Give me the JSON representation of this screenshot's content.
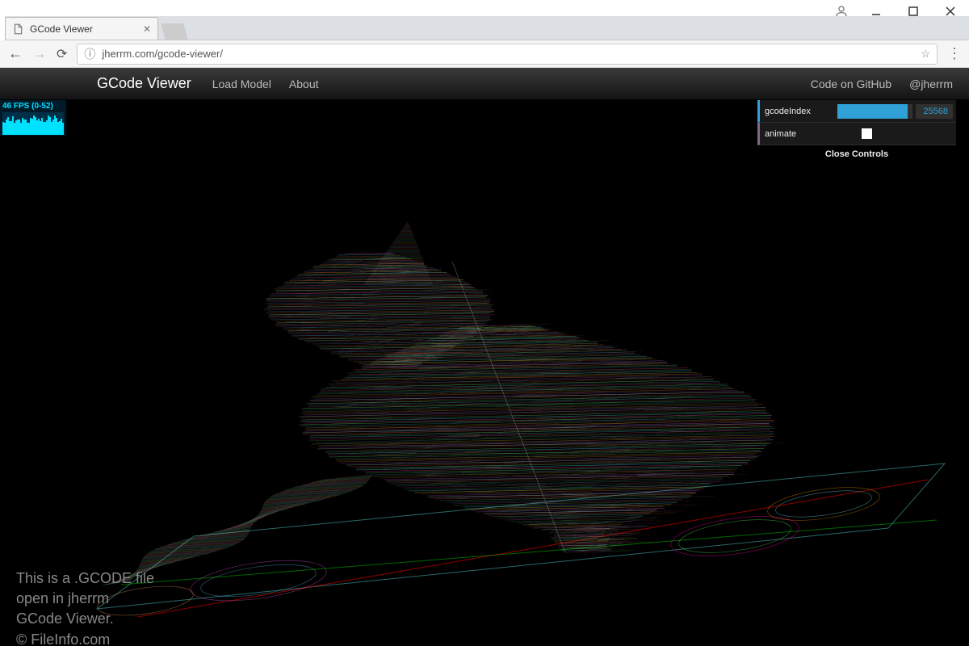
{
  "window": {
    "tab_title": "GCode Viewer",
    "url_display": "jherrm.com/gcode-viewer/"
  },
  "navbar": {
    "brand": "GCode Viewer",
    "links_left": [
      "Load Model",
      "About"
    ],
    "links_right": [
      "Code on GitHub",
      "@jherrm"
    ]
  },
  "fps": {
    "label": "46 FPS (0-52)"
  },
  "gui": {
    "rows": [
      {
        "label": "gcodeIndex",
        "type": "number",
        "value": "25568",
        "fill_pct": 94
      },
      {
        "label": "animate",
        "type": "boolean",
        "checked": false
      }
    ],
    "close_label": "Close Controls"
  },
  "caption": {
    "line1": "This is a .GCODE file",
    "line2": "open in jherrm",
    "line3": "GCode Viewer.",
    "line4": "© FileInfo.com"
  },
  "colors": {
    "accent": "#2fa1d6",
    "fps_cyan": "#00e0ff"
  }
}
